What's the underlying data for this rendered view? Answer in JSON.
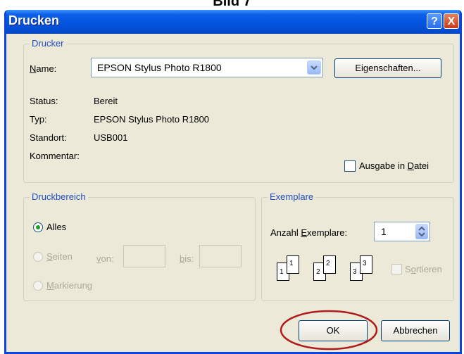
{
  "caption": "Bild 7",
  "dialog": {
    "title": "Drucken",
    "help_icon": "?",
    "close_icon": "X"
  },
  "printer_group": {
    "legend": "Drucker",
    "name_label": "Name:",
    "name_value": "EPSON Stylus Photo R1800",
    "properties_button": "Eigenschaften...",
    "status_label": "Status:",
    "status_value": "Bereit",
    "type_label": "Typ:",
    "type_value": "EPSON Stylus Photo R1800",
    "location_label": "Standort:",
    "location_value": "USB001",
    "comment_label": "Kommentar:",
    "print_to_file_label": "Ausgabe in Datei"
  },
  "range_group": {
    "legend": "Druckbereich",
    "all_label": "Alles",
    "pages_label": "Seiten",
    "from_label": "von:",
    "to_label": "bis:",
    "selection_label": "Markierung"
  },
  "copies_group": {
    "legend": "Exemplare",
    "count_label": "Anzahl Exemplare:",
    "count_value": "1",
    "pages": [
      "1",
      "1",
      "2",
      "2",
      "3",
      "3"
    ],
    "collate_label": "Sortieren"
  },
  "buttons": {
    "ok": "OK",
    "cancel": "Abbrechen"
  },
  "colors": {
    "titlebar": "#0553dc",
    "legend_text": "#1f4fc8",
    "highlight_ellipse": "#b01c1c"
  }
}
